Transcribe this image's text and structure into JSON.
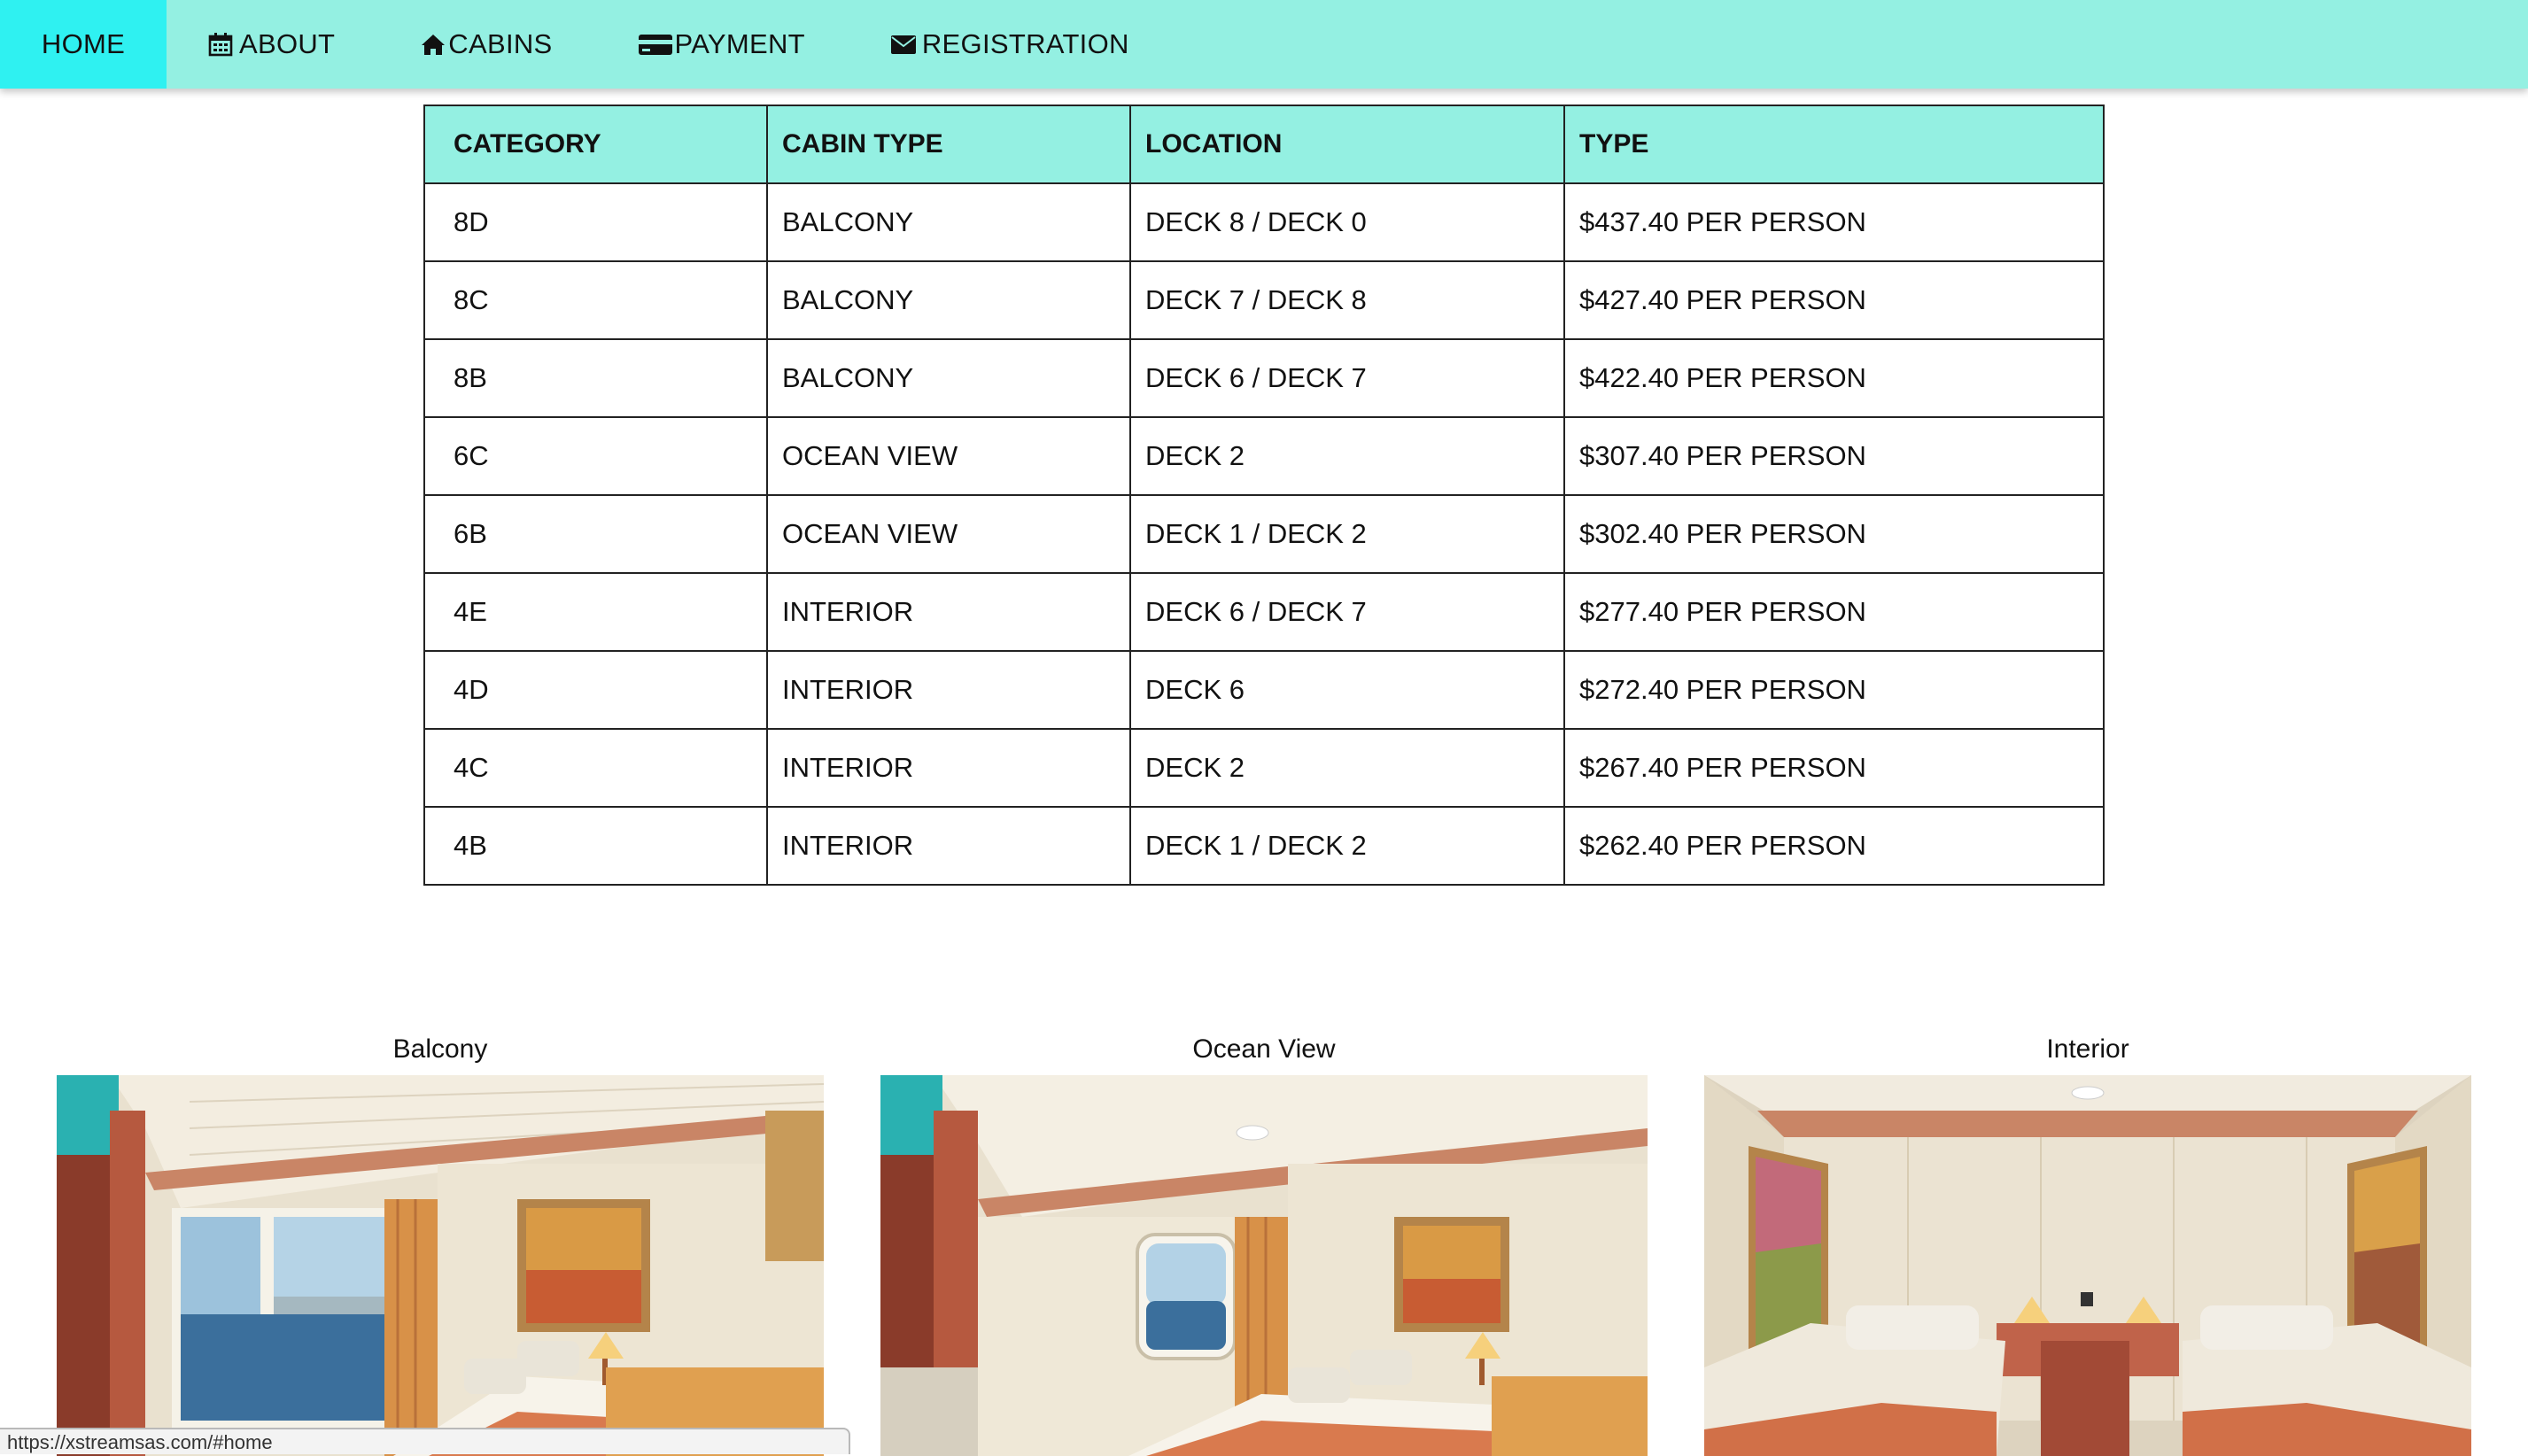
{
  "nav": {
    "items": [
      {
        "label": "HOME",
        "icon": "none",
        "active": true
      },
      {
        "label": "ABOUT",
        "icon": "calendar-icon",
        "active": false
      },
      {
        "label": "CABINS",
        "icon": "home-icon",
        "active": false
      },
      {
        "label": "PAYMENT",
        "icon": "credit-card-icon",
        "active": false
      },
      {
        "label": "REGISTRATION",
        "icon": "envelope-icon",
        "active": false
      }
    ]
  },
  "table": {
    "headers": [
      "CATEGORY",
      "CABIN TYPE",
      "LOCATION",
      "TYPE"
    ],
    "rows": [
      [
        "8D",
        "BALCONY",
        "DECK 8 / DECK 0",
        "$437.40 PER PERSON"
      ],
      [
        "8C",
        "BALCONY",
        "DECK 7 / DECK 8",
        "$427.40 PER PERSON"
      ],
      [
        "8B",
        "BALCONY",
        "DECK 6 / DECK 7",
        "$422.40 PER PERSON"
      ],
      [
        "6C",
        "OCEAN VIEW",
        "DECK 2",
        "$307.40 PER PERSON"
      ],
      [
        "6B",
        "OCEAN VIEW",
        "DECK 1 / DECK 2",
        "$302.40 PER PERSON"
      ],
      [
        "4E",
        "INTERIOR",
        "DECK 6 / DECK 7",
        "$277.40 PER PERSON"
      ],
      [
        "4D",
        "INTERIOR",
        "DECK 6",
        "$272.40 PER PERSON"
      ],
      [
        "4C",
        "INTERIOR",
        "DECK 2",
        "$267.40 PER PERSON"
      ],
      [
        "4B",
        "INTERIOR",
        "DECK 1 / DECK 2",
        "$262.40 PER PERSON"
      ]
    ]
  },
  "gallery": [
    {
      "caption": "Balcony"
    },
    {
      "caption": "Ocean View"
    },
    {
      "caption": "Interior"
    }
  ],
  "status_bar": {
    "url": "https://xstreamsas.com/#home"
  },
  "colors": {
    "nav_bg": "#94f0e2",
    "nav_active": "#2ff1f1",
    "table_header_bg": "#94f0e2"
  }
}
